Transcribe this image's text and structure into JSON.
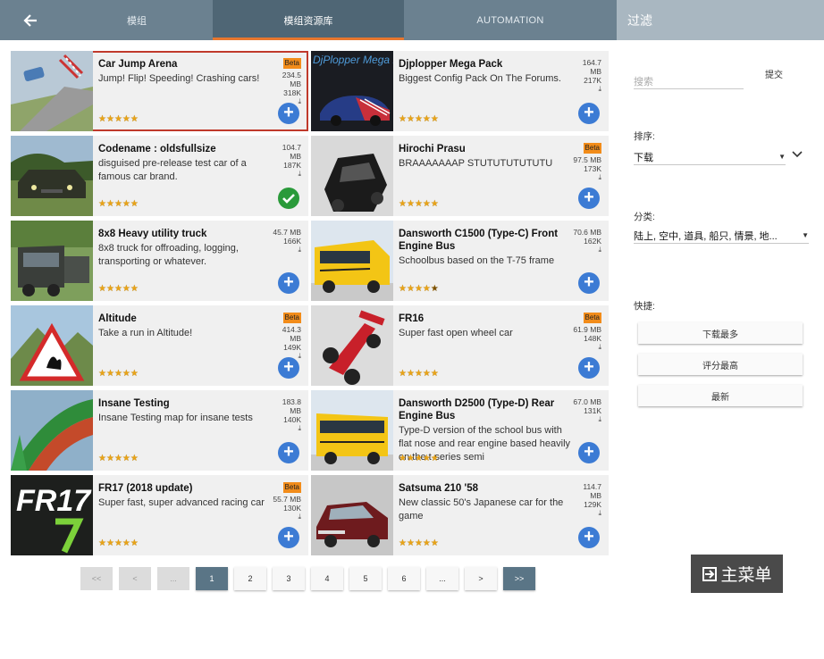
{
  "header": {
    "tabs": [
      {
        "label": "模组"
      },
      {
        "label": "模组资源库"
      },
      {
        "label": "AUTOMATION"
      }
    ],
    "filter_title": "过滤"
  },
  "mods": [
    {
      "title": "Car Jump Arena",
      "desc": "Jump! Flip! Speeding! Crashing cars!",
      "beta": "Beta",
      "size": "234.5 MB",
      "downloads": "318K",
      "rating": 5,
      "action": "add",
      "thumb": "jump"
    },
    {
      "title": "Djplopper Mega Pack",
      "desc": "Biggest Config Pack On The Forums.",
      "beta": "",
      "size": "164.7 MB",
      "downloads": "217K",
      "rating": 5,
      "action": "add",
      "thumb": "djplopper",
      "thumb_text": "DjPlopper Mega Pack"
    },
    {
      "title": "Codename : oldsfullsize",
      "desc": "disguised pre-release test car of a famous car brand.",
      "beta": "",
      "size": "104.7 MB",
      "downloads": "187K",
      "rating": 5,
      "action": "installed",
      "thumb": "oldcar"
    },
    {
      "title": "Hirochi Prasu",
      "desc": "BRAAAAAAAP STUTUTUTUTUTU",
      "beta": "Beta",
      "size": "97.5 MB",
      "downloads": "173K",
      "rating": 5,
      "action": "add",
      "thumb": "prasu"
    },
    {
      "title": "8x8 Heavy utility truck",
      "desc": "8x8 truck for offroading, logging, transporting or whatever.",
      "beta": "",
      "size": "45.7 MB",
      "downloads": "166K",
      "rating": 5,
      "action": "add",
      "thumb": "truck"
    },
    {
      "title": "Dansworth C1500 (Type-C) Front Engine Bus",
      "desc": "Schoolbus based on the T-75 frame",
      "beta": "",
      "size": "70.6 MB",
      "downloads": "162K",
      "rating": 4.5,
      "action": "add",
      "thumb": "bus"
    },
    {
      "title": "Altitude",
      "desc": "Take a run in Altitude!",
      "beta": "Beta",
      "size": "414.3 MB",
      "downloads": "149K",
      "rating": 5,
      "action": "add",
      "thumb": "altitude"
    },
    {
      "title": "FR16",
      "desc": "Super fast open wheel car",
      "beta": "Beta",
      "size": "61.9 MB",
      "downloads": "148K",
      "rating": 5,
      "action": "add",
      "thumb": "fr16"
    },
    {
      "title": "Insane Testing",
      "desc": "Insane Testing map for insane tests",
      "beta": "",
      "size": "183.8 MB",
      "downloads": "140K",
      "rating": 5,
      "action": "add",
      "thumb": "insane"
    },
    {
      "title": "Dansworth D2500 (Type-D) Rear Engine Bus",
      "desc": "Type-D version of the school bus with flat nose and rear engine based heavily on the t-series semi",
      "beta": "",
      "size": "67.0 MB",
      "downloads": "131K",
      "rating": 5,
      "action": "add",
      "thumb": "bus2"
    },
    {
      "title": "FR17 (2018 update)",
      "desc": "Super fast, super advanced racing car",
      "beta": "Beta",
      "size": "55.7 MB",
      "downloads": "130K",
      "rating": 5,
      "action": "add",
      "thumb": "fr17",
      "thumb_text": "FR17"
    },
    {
      "title": "Satsuma 210 '58",
      "desc": "New classic 50's Japanese car for the game",
      "beta": "",
      "size": "114.7 MB",
      "downloads": "129K",
      "rating": 5,
      "action": "add",
      "thumb": "satsuma"
    }
  ],
  "pagination": [
    "<<",
    "<",
    "...",
    "1",
    "2",
    "3",
    "4",
    "5",
    "6",
    "...",
    ">",
    ">>"
  ],
  "sidebar": {
    "search_placeholder": "搜索",
    "submit_label": "提交",
    "sort_label": "排序:",
    "sort_value": "下载",
    "category_label": "分类:",
    "category_value": "陆上, 空中, 道具, 船只, 情景, 地...",
    "quick_label": "快捷:",
    "quick_buttons": [
      "下载最多",
      "评分最高",
      "最新"
    ]
  },
  "main_menu_label": "主菜单",
  "colors": {
    "accent": "#e8772e",
    "topbar": "#6b8190",
    "add": "#3c7bd4",
    "installed": "#2a9a3a",
    "beta": "#f28c1a"
  }
}
